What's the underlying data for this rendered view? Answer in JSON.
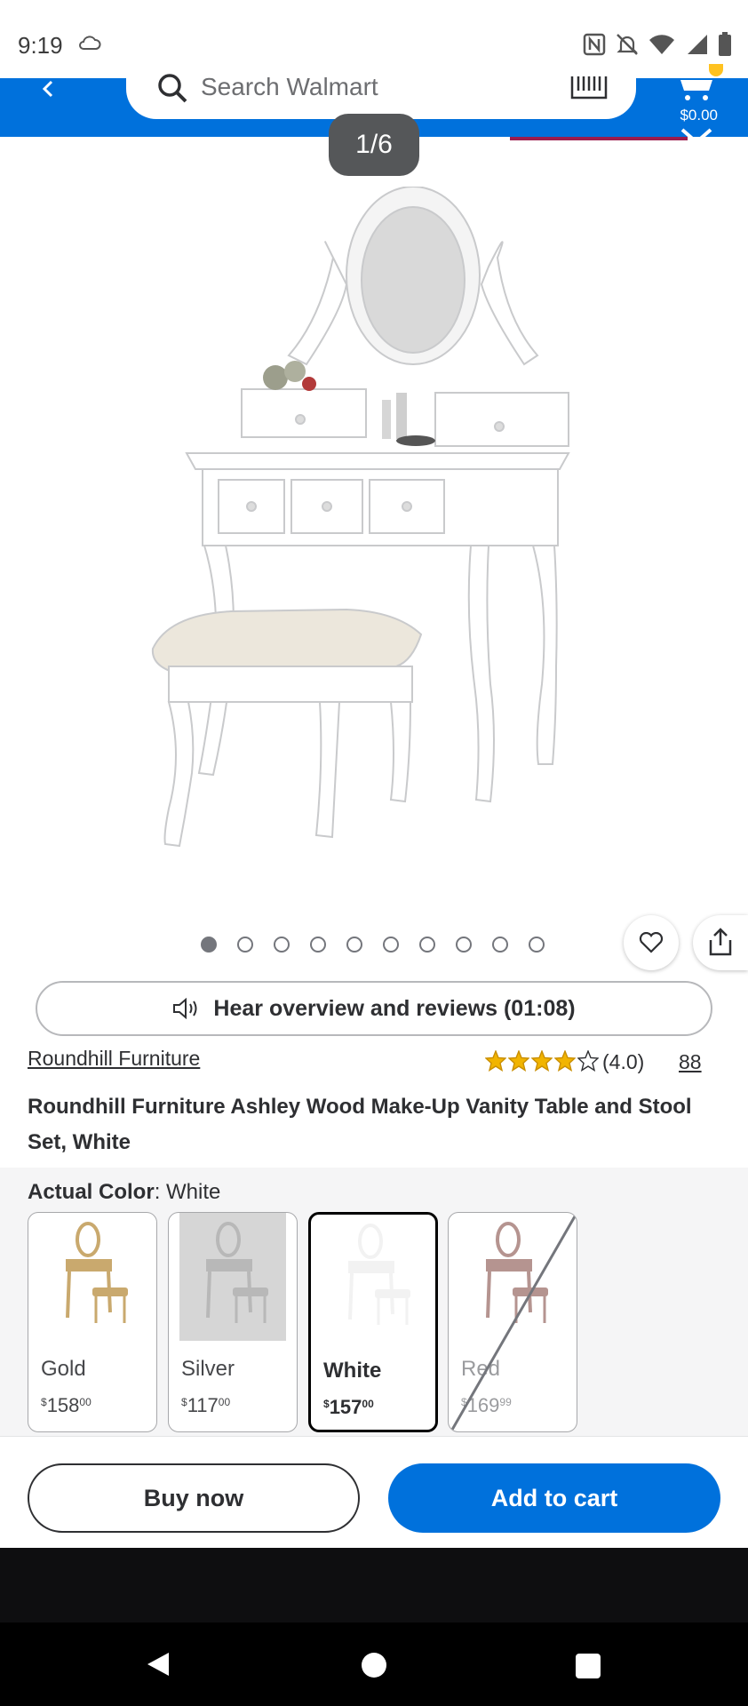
{
  "status_bar": {
    "time": "9:19"
  },
  "header": {
    "search_placeholder": "Search Walmart",
    "cart_total": "$0.00",
    "brand_color": "#0071dc"
  },
  "gallery": {
    "counter": "1/6",
    "dot_count": 10,
    "active_dot": 0
  },
  "audio": {
    "label": "Hear overview and reviews (01:08)"
  },
  "product": {
    "brand": "Roundhill Furniture",
    "rating": 4.0,
    "rating_text": "(4.0)",
    "review_count": "88",
    "title": "Roundhill Furniture Ashley Wood Make-Up Vanity Table and Stool Set, White"
  },
  "variants": {
    "label": "Actual Color",
    "selected_value": "White",
    "options": [
      {
        "name": "Gold",
        "price_dollars": "158",
        "price_cents": "00",
        "currency": "$",
        "selected": false,
        "available": true,
        "tone": "#c9a96e"
      },
      {
        "name": "Silver",
        "price_dollars": "117",
        "price_cents": "00",
        "currency": "$",
        "selected": false,
        "available": true,
        "tone": "#b8b8b8"
      },
      {
        "name": "White",
        "price_dollars": "157",
        "price_cents": "00",
        "currency": "$",
        "selected": true,
        "available": true,
        "tone": "#f2f2f2"
      },
      {
        "name": "Red",
        "price_dollars": "169",
        "price_cents": "99",
        "currency": "$",
        "selected": false,
        "available": false,
        "tone": "#b59490"
      }
    ]
  },
  "actions": {
    "buy_now": "Buy now",
    "add_to_cart": "Add to cart"
  },
  "icons": {
    "back": "chevron-left-icon",
    "search": "search-icon",
    "barcode": "barcode-icon",
    "cart": "cart-icon",
    "close": "close-icon",
    "favorite": "heart-icon",
    "share": "share-icon",
    "audio": "speaker-icon"
  }
}
